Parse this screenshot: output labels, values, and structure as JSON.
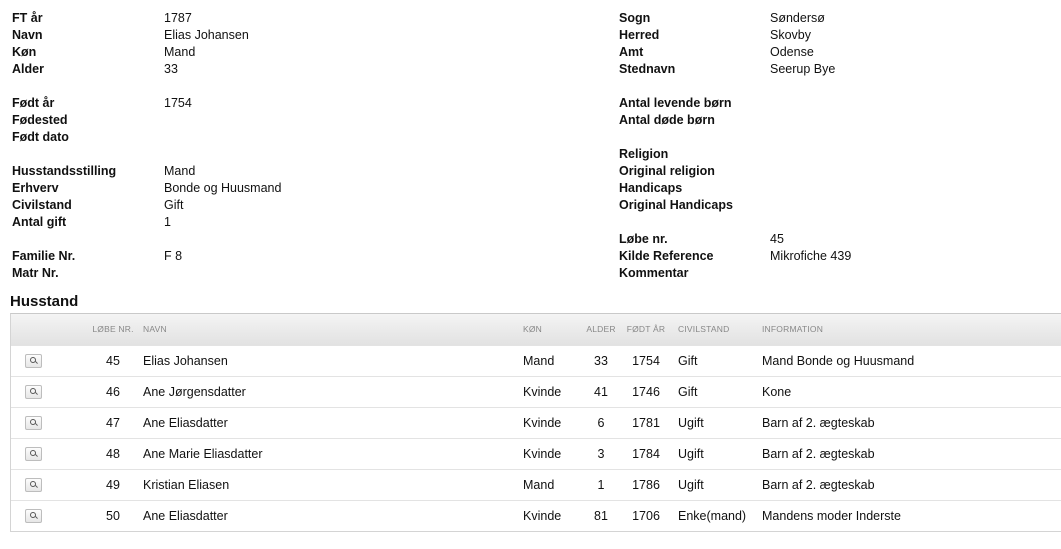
{
  "person_left": [
    {
      "label": "FT år",
      "value": "1787"
    },
    {
      "label": "Navn",
      "value": "Elias Johansen"
    },
    {
      "label": "Køn",
      "value": "Mand"
    },
    {
      "label": "Alder",
      "value": "33"
    },
    null,
    {
      "label": "Født år",
      "value": "1754"
    },
    {
      "label": "Fødested",
      "value": ""
    },
    {
      "label": "Født dato",
      "value": ""
    },
    null,
    {
      "label": "Husstandsstilling",
      "value": "Mand"
    },
    {
      "label": "Erhverv",
      "value": "Bonde og Huusmand"
    },
    {
      "label": "Civilstand",
      "value": "Gift"
    },
    {
      "label": "Antal gift",
      "value": "1"
    },
    null,
    {
      "label": "Familie Nr.",
      "value": "F 8"
    },
    {
      "label": "Matr Nr.",
      "value": ""
    }
  ],
  "person_right": [
    {
      "label": "Sogn",
      "value": "Søndersø"
    },
    {
      "label": "Herred",
      "value": "Skovby"
    },
    {
      "label": "Amt",
      "value": "Odense"
    },
    {
      "label": "Stednavn",
      "value": "Seerup Bye"
    },
    null,
    {
      "label": "Antal levende børn",
      "value": ""
    },
    {
      "label": "Antal døde børn",
      "value": ""
    },
    null,
    {
      "label": "Religion",
      "value": ""
    },
    {
      "label": "Original religion",
      "value": ""
    },
    {
      "label": "Handicaps",
      "value": ""
    },
    {
      "label": "Original Handicaps",
      "value": ""
    },
    null,
    {
      "label": "Løbe nr.",
      "value": "45"
    },
    {
      "label": "Kilde Reference",
      "value": "Mikrofiche 439"
    },
    {
      "label": "Kommentar",
      "value": ""
    }
  ],
  "husstand": {
    "title": "Husstand",
    "columns": {
      "lobe": "LØBE NR.",
      "navn": "NAVN",
      "kon": "KØN",
      "alder": "ALDER",
      "fodt": "FØDT ÅR",
      "civ": "CIVILSTAND",
      "info": "INFORMATION"
    },
    "rows": [
      {
        "lobe": "45",
        "navn": "Elias Johansen",
        "kon": "Mand",
        "alder": "33",
        "fodt": "1754",
        "civ": "Gift",
        "info": "Mand Bonde og Huusmand"
      },
      {
        "lobe": "46",
        "navn": "Ane Jørgensdatter",
        "kon": "Kvinde",
        "alder": "41",
        "fodt": "1746",
        "civ": "Gift",
        "info": "Kone"
      },
      {
        "lobe": "47",
        "navn": "Ane Eliasdatter",
        "kon": "Kvinde",
        "alder": "6",
        "fodt": "1781",
        "civ": "Ugift",
        "info": "Barn af 2. ægteskab"
      },
      {
        "lobe": "48",
        "navn": "Ane Marie Eliasdatter",
        "kon": "Kvinde",
        "alder": "3",
        "fodt": "1784",
        "civ": "Ugift",
        "info": "Barn af 2. ægteskab"
      },
      {
        "lobe": "49",
        "navn": "Kristian Eliasen",
        "kon": "Mand",
        "alder": "1",
        "fodt": "1786",
        "civ": "Ugift",
        "info": "Barn af 2. ægteskab"
      },
      {
        "lobe": "50",
        "navn": "Ane Eliasdatter",
        "kon": "Kvinde",
        "alder": "81",
        "fodt": "1706",
        "civ": "Enke(mand)",
        "info": "Mandens moder Inderste"
      }
    ]
  },
  "icons": {
    "detail": "magnifier-icon"
  }
}
